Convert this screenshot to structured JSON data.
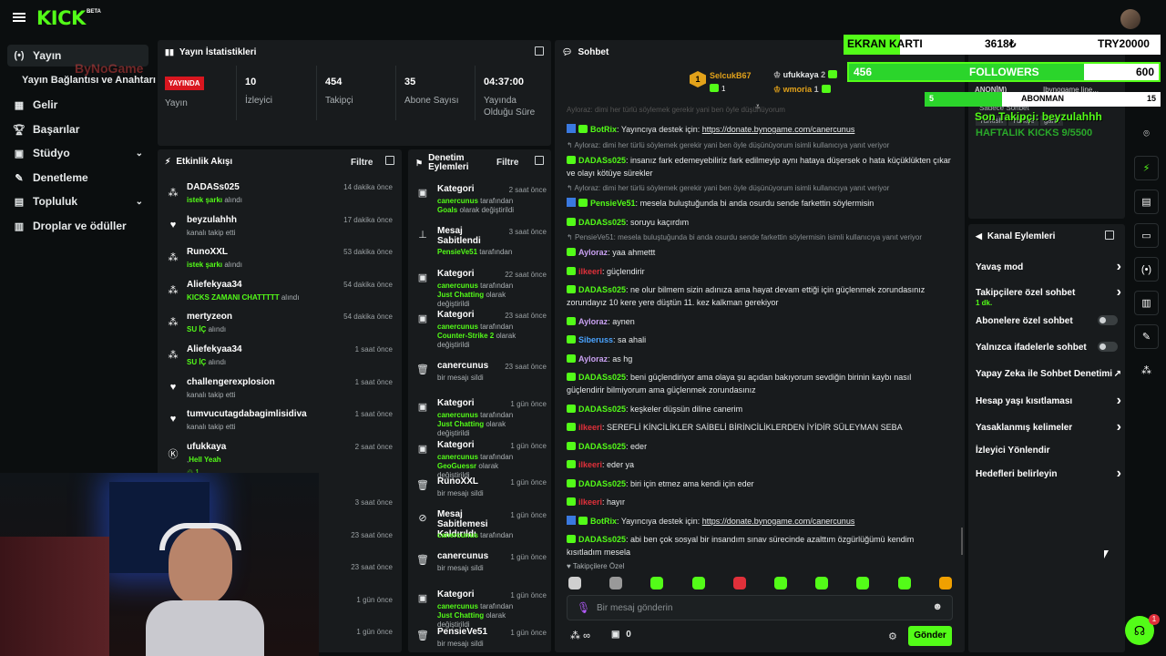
{
  "topbar": {
    "logo": "KICK",
    "beta": "BETA"
  },
  "sidebar": {
    "items": [
      {
        "label": "Yayın",
        "icon": "broadcast-icon"
      },
      {
        "label": "Yayın Bağlantısı ve Anahtarı"
      },
      {
        "label": "Gelir",
        "icon": "chart-icon"
      },
      {
        "label": "Başarılar",
        "icon": "trophy-icon"
      },
      {
        "label": "Stüdyo",
        "icon": "studio-icon"
      },
      {
        "label": "Denetleme",
        "icon": "wrench-icon"
      },
      {
        "label": "Topluluk",
        "icon": "community-icon"
      },
      {
        "label": "Droplar ve ödüller",
        "icon": "gift-icon"
      }
    ],
    "watermark": "ByNoGame"
  },
  "stats": {
    "title": "Yayın İstatistikleri",
    "live_badge": "YAYINDA",
    "live_label": "Yayın",
    "viewers": "10",
    "viewers_label": "İzleyici",
    "followers": "454",
    "followers_label": "Takipçi",
    "subs": "35",
    "subs_label": "Abone Sayısı",
    "uptime": "04:37:00",
    "uptime_label": "Yayında Olduğu Süre"
  },
  "activity": {
    "title": "Etkinlik Akışı",
    "filter": "Filtre",
    "rows": [
      {
        "name": "DADASs025",
        "pre": "",
        "hl": "istek şarkı",
        "post": " alındı",
        "time": "14 dakika önce",
        "icon": "gift-icon"
      },
      {
        "name": "beyzulahhh",
        "pre": "kanalı takip etti",
        "hl": "",
        "post": "",
        "time": "17 dakika önce",
        "icon": "heart-icon"
      },
      {
        "name": "RunoXXL",
        "pre": "",
        "hl": "istek şarkı",
        "post": " alındı",
        "time": "53 dakika önce",
        "icon": "gift-icon"
      },
      {
        "name": "Aliefekyaa34",
        "pre": "",
        "hl": "KICKS ZAMANI CHATTTTT",
        "post": " alındı",
        "time": "54 dakika önce",
        "icon": "gift-icon"
      },
      {
        "name": "mertyzeon",
        "pre": "",
        "hl": "SU İÇ",
        "post": " alındı",
        "time": "54 dakika önce",
        "icon": "gift-icon"
      },
      {
        "name": "Aliefekyaa34",
        "pre": "",
        "hl": "SU İÇ",
        "post": " alındı",
        "time": "1 saat önce",
        "icon": "gift-icon"
      },
      {
        "name": "challengerexplosion",
        "pre": "kanalı takip etti",
        "hl": "",
        "post": "",
        "time": "1 saat önce",
        "icon": "heart-icon"
      },
      {
        "name": "tumvucutagdabagimlisidiva",
        "pre": "kanalı takip etti",
        "hl": "",
        "post": "",
        "time": "1 saat önce",
        "icon": "heart-icon"
      },
      {
        "name": "ufukkaya",
        "pre": ",",
        "hl": "Hell Yeah",
        "post": "",
        "time": "2 saat önce",
        "icon": "kick-icon"
      }
    ],
    "hidden_times": [
      "3 saat önce",
      "23 saat önce",
      "23 saat önce",
      "1 gün önce",
      "1 gün önce"
    ],
    "sub_count": "1"
  },
  "moderation": {
    "title": "Denetim Eylemleri",
    "filter": "Filtre",
    "rows": [
      {
        "title": "Kategori",
        "hl": "canercunus",
        "mid": " tarafından ",
        "hl2": "Goals",
        "post": " olarak değiştirildi",
        "time": "2 saat önce"
      },
      {
        "title": "Mesaj Sabitlendi",
        "hl": "PensieVe51",
        "mid": " tarafından",
        "hl2": "",
        "post": "",
        "time": "3 saat önce"
      },
      {
        "title": "Kategori",
        "hl": "canercunus",
        "mid": " tarafından ",
        "hl2": "Just Chatting",
        "post": " olarak değiştirildi",
        "time": "22 saat önce"
      },
      {
        "title": "Kategori",
        "hl": "canercunus",
        "mid": " tarafından ",
        "hl2": "Counter-Strike 2",
        "post": " olarak değiştirildi",
        "time": "23 saat önce"
      },
      {
        "title": "canercunus",
        "hl": "",
        "mid": "bir mesajı sildi",
        "hl2": "",
        "post": "",
        "time": "23 saat önce"
      },
      {
        "title": "Kategori",
        "hl": "canercunus",
        "mid": " tarafından ",
        "hl2": "Just Chatting",
        "post": " olarak değiştirildi",
        "time": "1 gün önce"
      },
      {
        "title": "Kategori",
        "hl": "canercunus",
        "mid": " tarafından ",
        "hl2": "GeoGuessr",
        "post": " olarak değiştirildi",
        "time": "1 gün önce"
      },
      {
        "title": "RunoXXL",
        "hl": "",
        "mid": "bir mesajı sildi",
        "hl2": "",
        "post": "",
        "time": "1 gün önce"
      },
      {
        "title": "Mesaj Sabitlemesi Kaldırıldı",
        "hl": "canercunus",
        "mid": " tarafından",
        "hl2": "",
        "post": "",
        "time": "1 gün önce"
      },
      {
        "title": "canercunus",
        "hl": "",
        "mid": "bir mesajı sildi",
        "hl2": "",
        "post": "",
        "time": "1 gün önce"
      },
      {
        "title": "Kategori",
        "hl": "canercunus",
        "mid": " tarafından ",
        "hl2": "Just Chatting",
        "post": " olarak değiştirildi",
        "time": "1 gün önce"
      },
      {
        "title": "PensieVe51",
        "hl": "",
        "mid": "bir mesajı sildi",
        "hl2": "",
        "post": "",
        "time": "1 gün önce"
      }
    ]
  },
  "chat": {
    "title": "Sohbet",
    "leaders": [
      {
        "name": "SelcukB67",
        "count": "1"
      },
      {
        "name": "ufukkaya",
        "count": "2"
      },
      {
        "name": "wmoria",
        "count": "1"
      }
    ],
    "cut_top": "Ayloraz: dimi her türlü söylemek gerekir yani ben öyle düşünüyorum",
    "messages": [
      {
        "user": "BotRix",
        "color": "#53fc18",
        "text": "Yayıncıya destek için: ",
        "link": "https://donate.bynogame.com/canercunus",
        "badge": "bot"
      },
      {
        "reply": "Ayloraz: dimi her türlü söylemek gerekir yani ben öyle düşünüyorum isimli kullanıcıya yanıt veriyor",
        "user": "DADASs025",
        "color": "#53fc18",
        "text": "insanız fark edemeyebiliriz fark edilmeyip aynı hataya düşersek o hata küçüklükten çıkar ve olayı kötüye sürekler"
      },
      {
        "reply": "Ayloraz: dimi her türlü söylemek gerekir yani ben öyle düşünüyorum isimli kullanıcıya yanıt veriyor",
        "user": "PensieVe51",
        "color": "#53fc18",
        "text": "mesela buluştuğunda bi anda osurdu sende farkettin söylermisin",
        "badge": "bot"
      },
      {
        "user": "DADASs025",
        "color": "#53fc18",
        "text": "soruyu kaçırdım"
      },
      {
        "reply": "PensieVe51: mesela buluştuğunda bi anda osurdu sende farkettin söylermisin isimli kullanıcıya yanıt veriyor",
        "user": "Ayloraz",
        "color": "#c8a0f0",
        "text": "yaa ahmettt"
      },
      {
        "user": "ilkeeri",
        "color": "#e0303a",
        "text": "güçlendirir"
      },
      {
        "user": "DADASs025",
        "color": "#53fc18",
        "text": "ne olur bilmem sizin adınıza ama hayat devam ettiği için güçlenmek zorundasınız zorundayız 10 kere yere düştün 11. kez kalkman gerekiyor"
      },
      {
        "user": "Ayloraz",
        "color": "#c8a0f0",
        "text": "aynen"
      },
      {
        "user": "Siberuss",
        "color": "#4aa3ff",
        "text": "sa ahali"
      },
      {
        "user": "Ayloraz",
        "color": "#c8a0f0",
        "text": "as hg"
      },
      {
        "user": "DADASs025",
        "color": "#53fc18",
        "text": "beni güçlendiriyor ama olaya şu açıdan bakıyorum sevdiğin birinin kaybı nasıl güçlendirir bilmiyorum ama güçlenmek zorundasınız"
      },
      {
        "user": "DADASs025",
        "color": "#53fc18",
        "text": "keşkeler düşsün diline canerim"
      },
      {
        "user": "ilkeeri",
        "color": "#e0303a",
        "text": "SEREFLİ KİNCİLİKLER SAİBELİ BİRİNCİLİKLERDEN İYİDİR SÜLEYMAN SEBA"
      },
      {
        "user": "DADASs025",
        "color": "#53fc18",
        "text": "eder"
      },
      {
        "user": "ilkeeri",
        "color": "#e0303a",
        "text": "eder ya"
      },
      {
        "user": "DADASs025",
        "color": "#53fc18",
        "text": "biri için etmez ama kendi için eder"
      },
      {
        "user": "ilkeeri",
        "color": "#e0303a",
        "text": "hayır"
      },
      {
        "user": "BotRix",
        "color": "#53fc18",
        "text": "Yayıncıya destek için: ",
        "link": "https://donate.bynogame.com/canercunus",
        "badge": "bot"
      },
      {
        "user": "DADASs025",
        "color": "#53fc18",
        "text": "abi ben çok sosyal bir insandım sınav sürecinde azalttım özgürlüğümü kendim kısıtladım mesela"
      }
    ],
    "followers_only": "Takipçilere Özel",
    "placeholder": "Bir mesaj gönderin",
    "kicks": "∞",
    "points": "0",
    "send": "Gönder"
  },
  "overlay": {
    "gpu_label": "EKRAN KARTI",
    "gpu_price": "3618₺",
    "gpu_target": "TRY20000",
    "followers_current": "456",
    "followers_label": "FOLLOWERS",
    "followers_goal": "600",
    "followers_fraction": 0.76,
    "subs_current": "5",
    "subs_label": "ABONMAN",
    "subs_goal": "15",
    "subs_fraction": 0.33,
    "last_follower": "Son Takipçi: beyzulahhh",
    "weekly_kicks": "HAFTALIK KICKS 9/5500",
    "peek": [
      "ANONİM)",
      "Ibynogame line...",
      "Sadece Sohbet",
      "Turkish",
      "Türkçe",
      "gami"
    ]
  },
  "channel_actions": {
    "title": "Kanal Eylemleri",
    "rows": [
      {
        "label": "Yavaş mod",
        "type": "arrow"
      },
      {
        "label": "Takipçilere özel sohbet",
        "sub": "1 dk.",
        "type": "arrow"
      },
      {
        "label": "Abonelere özel sohbet",
        "type": "toggle"
      },
      {
        "label": "Yalnızca ifadelerle sohbet",
        "type": "toggle"
      },
      {
        "label": "Yapay Zeka ile Sohbet Denetimi",
        "type": "external"
      },
      {
        "label": "Hesap yaşı kısıtlaması",
        "type": "arrow"
      },
      {
        "label": "Yasaklanmış kelimeler",
        "type": "arrow"
      },
      {
        "label": "İzleyici Yönlendir",
        "type": "none"
      },
      {
        "label": "Hedefleri belirleyin",
        "type": "arrow"
      }
    ]
  },
  "support_badge": "1",
  "colors": {
    "accent": "#53fc18",
    "panel": "#181b1d",
    "bg": "#0b0e0f",
    "live": "#d9161f"
  }
}
